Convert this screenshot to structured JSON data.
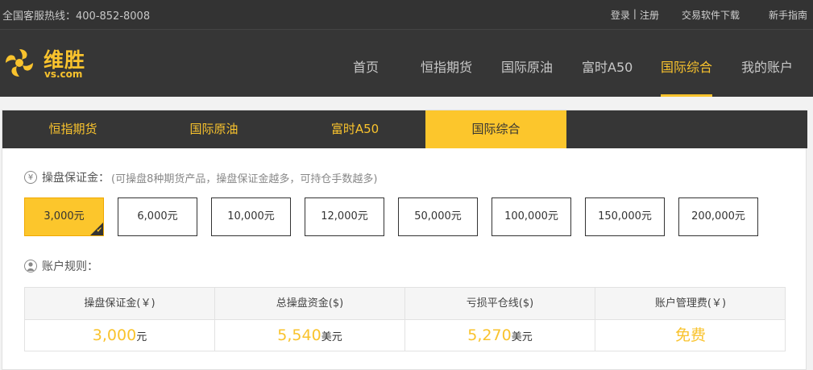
{
  "topbar": {
    "hotline": "全国客服热线：400-852-8008",
    "login": "登录",
    "separator": "|",
    "register": "注册",
    "download": "交易软件下载",
    "guide": "新手指南"
  },
  "logo": {
    "cn": "维胜",
    "en": "vs.com"
  },
  "nav": {
    "items": [
      "首页",
      "恒指期货",
      "国际原油",
      "富时A50",
      "国际综合",
      "我的账户"
    ],
    "active": "国际综合"
  },
  "tabs": {
    "items": [
      "恒指期货",
      "国际原油",
      "富时A50",
      "国际综合"
    ],
    "active": "国际综合"
  },
  "margin": {
    "icon_symbol": "¥",
    "title": "操盘保证金：",
    "hint": "(可操盘8种期货产品，操盘保证金越多，可持仓手数越多)",
    "options": [
      "3,000元",
      "6,000元",
      "10,000元",
      "12,000元",
      "50,000元",
      "100,000元",
      "150,000元",
      "200,000元"
    ],
    "selected": "3,000元"
  },
  "rules": {
    "title": "账户规则：",
    "headers": [
      "操盘保证金(￥)",
      "总操盘资金($)",
      "亏损平仓线($)",
      "账户管理费(￥)"
    ],
    "values": [
      {
        "num": "3,000",
        "unit": "元"
      },
      {
        "num": "5,540",
        "unit": "美元"
      },
      {
        "num": "5,270",
        "unit": "美元"
      },
      {
        "num": "免费",
        "unit": ""
      }
    ]
  },
  "colors": {
    "accent": "#f9c32d",
    "dark": "#363636"
  }
}
